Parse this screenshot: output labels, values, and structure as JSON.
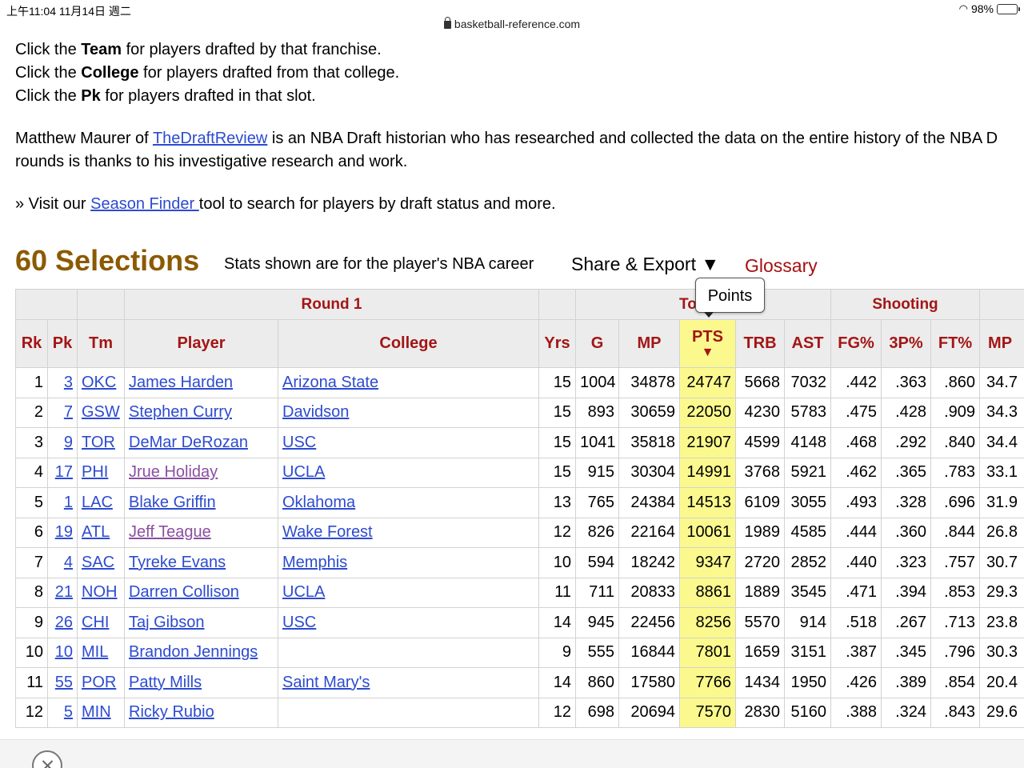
{
  "status": {
    "time": "上午11:04   11月14日 週二",
    "battery": "98%"
  },
  "browser": {
    "url": "basketball-reference.com"
  },
  "intro": {
    "line1": {
      "pre": "Click the ",
      "bold": "Team",
      "post": " for players drafted by that franchise."
    },
    "line2": {
      "pre": "Click the ",
      "bold": "College",
      "post": " for players drafted from that college."
    },
    "line3": {
      "pre": "Click the ",
      "bold": "Pk",
      "post": " for players drafted in that slot."
    },
    "para2_pre": "Matthew Maurer of ",
    "para2_link": "TheDraftReview",
    "para2_post": " is an NBA Draft historian who has researched and collected the data on the entire history of the NBA D",
    "para2_line2": "rounds is thanks to his investigative research and work.",
    "visit_pre": "» Visit our ",
    "visit_link": "Season Finder ",
    "visit_post": "tool to search for players by draft status and more."
  },
  "section": {
    "title": "60 Selections",
    "note": "Stats shown are for the player's NBA career",
    "share": "Share & Export ▼",
    "glossary": "Glossary"
  },
  "tooltip": {
    "text": "Points"
  },
  "table": {
    "over_headers": {
      "round": "Round 1",
      "totals": "To",
      "shooting": "Shooting"
    },
    "headers": {
      "rk": "Rk",
      "pk": "Pk",
      "tm": "Tm",
      "player": "Player",
      "college": "College",
      "yrs": "Yrs",
      "g": "G",
      "mp": "MP",
      "pts": "PTS",
      "pts_arrow": "▼",
      "trb": "TRB",
      "ast": "AST",
      "fg": "FG%",
      "three": "3P%",
      "ft": "FT%",
      "mpg": "MP"
    },
    "rows": [
      {
        "rk": "1",
        "pk": "3",
        "tm": "OKC",
        "player": "James Harden",
        "college": "Arizona State",
        "yrs": "15",
        "g": "1004",
        "mp": "34878",
        "pts": "24747",
        "trb": "5668",
        "ast": "7032",
        "fg": ".442",
        "three": ".363",
        "ft": ".860",
        "mpg": "34.7"
      },
      {
        "rk": "2",
        "pk": "7",
        "tm": "GSW",
        "player": "Stephen Curry",
        "college": "Davidson",
        "yrs": "15",
        "g": "893",
        "mp": "30659",
        "pts": "22050",
        "trb": "4230",
        "ast": "5783",
        "fg": ".475",
        "three": ".428",
        "ft": ".909",
        "mpg": "34.3"
      },
      {
        "rk": "3",
        "pk": "9",
        "tm": "TOR",
        "player": "DeMar DeRozan",
        "college": "USC",
        "yrs": "15",
        "g": "1041",
        "mp": "35818",
        "pts": "21907",
        "trb": "4599",
        "ast": "4148",
        "fg": ".468",
        "three": ".292",
        "ft": ".840",
        "mpg": "34.4"
      },
      {
        "rk": "4",
        "pk": "17",
        "tm": "PHI",
        "player": "Jrue Holiday",
        "college": "UCLA",
        "yrs": "15",
        "g": "915",
        "mp": "30304",
        "pts": "14991",
        "trb": "3768",
        "ast": "5921",
        "fg": ".462",
        "three": ".365",
        "ft": ".783",
        "mpg": "33.1"
      },
      {
        "rk": "5",
        "pk": "1",
        "tm": "LAC",
        "player": "Blake Griffin",
        "college": "Oklahoma",
        "yrs": "13",
        "g": "765",
        "mp": "24384",
        "pts": "14513",
        "trb": "6109",
        "ast": "3055",
        "fg": ".493",
        "three": ".328",
        "ft": ".696",
        "mpg": "31.9"
      },
      {
        "rk": "6",
        "pk": "19",
        "tm": "ATL",
        "player": "Jeff Teague",
        "college": "Wake Forest",
        "yrs": "12",
        "g": "826",
        "mp": "22164",
        "pts": "10061",
        "trb": "1989",
        "ast": "4585",
        "fg": ".444",
        "three": ".360",
        "ft": ".844",
        "mpg": "26.8"
      },
      {
        "rk": "7",
        "pk": "4",
        "tm": "SAC",
        "player": "Tyreke Evans",
        "college": "Memphis",
        "yrs": "10",
        "g": "594",
        "mp": "18242",
        "pts": "9347",
        "trb": "2720",
        "ast": "2852",
        "fg": ".440",
        "three": ".323",
        "ft": ".757",
        "mpg": "30.7"
      },
      {
        "rk": "8",
        "pk": "21",
        "tm": "NOH",
        "player": "Darren Collison",
        "college": "UCLA",
        "yrs": "11",
        "g": "711",
        "mp": "20833",
        "pts": "8861",
        "trb": "1889",
        "ast": "3545",
        "fg": ".471",
        "three": ".394",
        "ft": ".853",
        "mpg": "29.3"
      },
      {
        "rk": "9",
        "pk": "26",
        "tm": "CHI",
        "player": "Taj Gibson",
        "college": "USC",
        "yrs": "14",
        "g": "945",
        "mp": "22456",
        "pts": "8256",
        "trb": "5570",
        "ast": "914",
        "fg": ".518",
        "three": ".267",
        "ft": ".713",
        "mpg": "23.8"
      },
      {
        "rk": "10",
        "pk": "10",
        "tm": "MIL",
        "player": "Brandon Jennings",
        "college": "",
        "yrs": "9",
        "g": "555",
        "mp": "16844",
        "pts": "7801",
        "trb": "1659",
        "ast": "3151",
        "fg": ".387",
        "three": ".345",
        "ft": ".796",
        "mpg": "30.3"
      },
      {
        "rk": "11",
        "pk": "55",
        "tm": "POR",
        "player": "Patty Mills",
        "college": "Saint Mary's",
        "yrs": "14",
        "g": "860",
        "mp": "17580",
        "pts": "7766",
        "trb": "1434",
        "ast": "1950",
        "fg": ".426",
        "three": ".389",
        "ft": ".854",
        "mpg": "20.4"
      },
      {
        "rk": "12",
        "pk": "5",
        "tm": "MIN",
        "player": "Ricky Rubio",
        "college": "",
        "yrs": "12",
        "g": "698",
        "mp": "20694",
        "pts": "7570",
        "trb": "2830",
        "ast": "5160",
        "fg": ".388",
        "three": ".324",
        "ft": ".843",
        "mpg": "29.6"
      }
    ]
  }
}
